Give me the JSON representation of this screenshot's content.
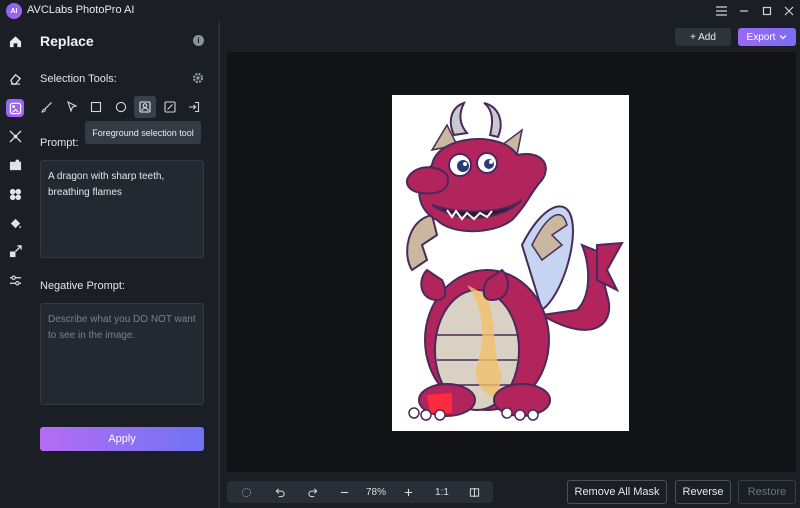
{
  "window": {
    "app_title": "AVCLabs PhotoPro AI",
    "logo_text": "AI",
    "controls": [
      "menu-icon",
      "minimize-icon",
      "maximize-icon",
      "close-icon"
    ]
  },
  "rail": {
    "items": [
      {
        "icon": "home-icon",
        "active": false
      },
      {
        "icon": "eraser-icon",
        "active": false
      },
      {
        "icon": "replace-icon",
        "active": true
      },
      {
        "icon": "expand-icon",
        "active": false
      },
      {
        "icon": "background-icon",
        "active": false
      },
      {
        "icon": "colorize-icon",
        "active": false
      },
      {
        "icon": "paint-bucket-icon",
        "active": false
      },
      {
        "icon": "upscale-icon",
        "active": false
      },
      {
        "icon": "adjust-icon",
        "active": false
      }
    ]
  },
  "panel": {
    "title": "Replace",
    "selection_tools_label": "Selection Tools:",
    "tools": [
      {
        "icon": "brush-icon",
        "active": false
      },
      {
        "icon": "pointer-icon",
        "active": false
      },
      {
        "icon": "rectangle-icon",
        "active": false
      },
      {
        "icon": "ellipse-icon",
        "active": false
      },
      {
        "icon": "foreground-select-icon",
        "active": true
      },
      {
        "icon": "ai-select-icon",
        "active": false
      },
      {
        "icon": "import-mask-icon",
        "active": false
      }
    ],
    "tooltip": "Foreground selection tool",
    "prompt_label": "Prompt:",
    "prompt_value": "A dragon with sharp teeth, breathing flames",
    "negative_label": "Negative Prompt:",
    "negative_placeholder": "Describe what you DO NOT want to see in the image.",
    "apply_label": "Apply"
  },
  "toolbar": {
    "add_label": "+ Add",
    "export_label": "Export"
  },
  "bottom": {
    "zoom_level": "78%",
    "ratio_label": "1:1",
    "remove_mask_label": "Remove All Mask",
    "reverse_label": "Reverse",
    "restore_label": "Restore"
  },
  "colors": {
    "accent": "#8a6cf7",
    "dragon_body": "#b1245c",
    "dragon_belly": "#d9d2c4",
    "dragon_wing": "#c9b7a0"
  }
}
